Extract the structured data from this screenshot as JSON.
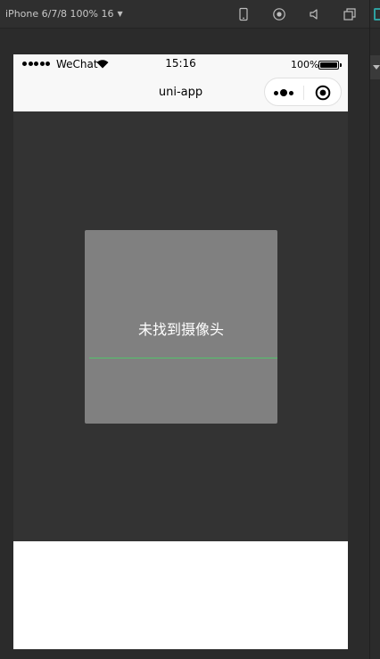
{
  "devtools": {
    "device_label": "iPhone 6/7/8 100% 16",
    "icons": [
      "phone-preview-icon",
      "record-icon",
      "sound-icon",
      "window-icon"
    ]
  },
  "status_bar": {
    "carrier": "WeChat",
    "time": "15:16",
    "battery": "100%"
  },
  "nav": {
    "title": "uni-app"
  },
  "scanner": {
    "message": "未找到摄像头"
  },
  "colors": {
    "background": "#333333",
    "scan_box": "#808080",
    "scan_line": "#53c36b",
    "nav_bar": "#f8f8f8"
  }
}
